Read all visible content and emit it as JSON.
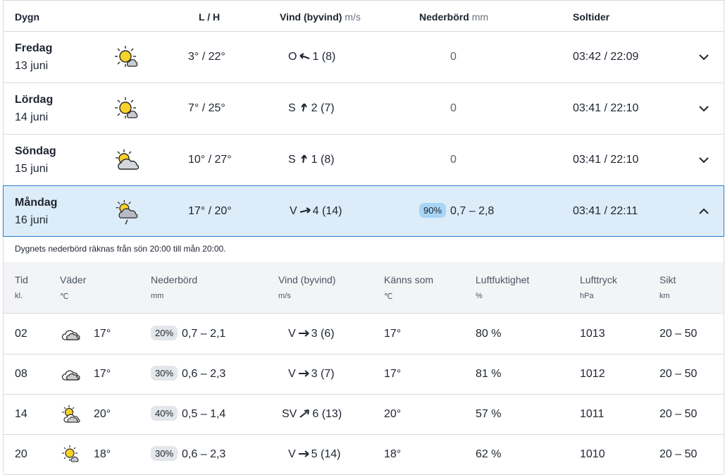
{
  "header": {
    "dygn": "Dygn",
    "lh": "L / H",
    "wind": "Vind (byvind)",
    "wind_unit": "m/s",
    "prec": "Nederbörd",
    "prec_unit": "mm",
    "sun": "Soltider"
  },
  "days": [
    {
      "name": "Fredag",
      "date": "13 juni",
      "icon": "sun-partly-cloudy-icon",
      "lh": "3° / 22°",
      "wind_dir": "O",
      "wind_val": "1 (8)",
      "prec": "0",
      "sun": "03:42 / 22:09"
    },
    {
      "name": "Lördag",
      "date": "14 juni",
      "icon": "sun-partly-cloudy-icon",
      "lh": "7° / 25°",
      "wind_dir": "S",
      "wind_val": "2 (7)",
      "prec": "0",
      "sun": "03:41 / 22:10"
    },
    {
      "name": "Söndag",
      "date": "15 juni",
      "icon": "cloud-sun-icon",
      "lh": "10° / 27°",
      "wind_dir": "S",
      "wind_val": "1 (8)",
      "prec": "0",
      "sun": "03:41 / 22:10"
    },
    {
      "name": "Måndag",
      "date": "16 juni",
      "icon": "cloud-sun-rain-icon",
      "lh": "17° / 20°",
      "wind_dir": "V",
      "wind_val": "4 (14)",
      "prec_chance": "90%",
      "prec": "0,7 – 2,8",
      "sun": "03:41 / 22:11"
    }
  ],
  "note": "Dygnets nederbörd räknas från sön 20:00 till mån 20:00.",
  "table_headers": [
    {
      "label": "Tid",
      "unit": "kl."
    },
    {
      "label": "Väder",
      "unit": "℃"
    },
    {
      "label": "Nederbörd",
      "unit": "mm"
    },
    {
      "label": "Vind (byvind)",
      "unit": "m/s"
    },
    {
      "label": "Känns som",
      "unit": "℃"
    },
    {
      "label": "Luftfuktighet",
      "unit": "%"
    },
    {
      "label": "Lufttryck",
      "unit": "hPa"
    },
    {
      "label": "Sikt",
      "unit": "km"
    }
  ],
  "hours": [
    {
      "time": "02",
      "icon": "cloudy-icon",
      "temp": "17°",
      "chance": "20%",
      "prec": "0,7 – 2,1",
      "wind_dir": "V",
      "wind_val": "3 (6)",
      "feels": "17°",
      "humidity": "80 %",
      "pressure": "1013",
      "vis": "20 – 50"
    },
    {
      "time": "08",
      "icon": "cloudy-icon",
      "temp": "17°",
      "chance": "30%",
      "prec": "0,6 – 2,3",
      "wind_dir": "V",
      "wind_val": "3 (7)",
      "feels": "17°",
      "humidity": "81 %",
      "pressure": "1012",
      "vis": "20 – 50"
    },
    {
      "time": "14",
      "icon": "sun-cloud-icon",
      "temp": "20°",
      "chance": "40%",
      "prec": "0,5 – 1,4",
      "wind_dir": "SV",
      "wind_val": "6 (13)",
      "feels": "20°",
      "humidity": "57 %",
      "pressure": "1011",
      "vis": "20 – 50"
    },
    {
      "time": "20",
      "icon": "sun-partly-cloudy-icon",
      "temp": "18°",
      "chance": "30%",
      "prec": "0,6 – 2,3",
      "wind_dir": "V",
      "wind_val": "5 (14)",
      "feels": "18°",
      "humidity": "62 %",
      "pressure": "1010",
      "vis": "20 – 50"
    }
  ]
}
